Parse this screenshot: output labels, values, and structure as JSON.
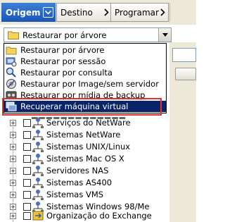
{
  "tabs": [
    {
      "label": "Origem",
      "active": true
    },
    {
      "label": "Destino",
      "active": false
    },
    {
      "label": "Programar",
      "active": false
    }
  ],
  "combo": {
    "value": "Restaurar por árvore"
  },
  "dropdown": {
    "items": [
      {
        "label": "Restaurar por árvore",
        "icon": "folder-icon"
      },
      {
        "label": "Restaurar por sessão",
        "icon": "session-icon"
      },
      {
        "label": "Restaurar por consulta",
        "icon": "query-icon"
      },
      {
        "label": "Restaurar por Image/sem servidor",
        "icon": "image-serverless-icon"
      },
      {
        "label": "Restaurar por mídia de backup",
        "icon": "backup-media-icon"
      },
      {
        "label": "Recuperar máquina virtual",
        "icon": "virtual-machine-icon",
        "selected": true
      }
    ]
  },
  "tree": {
    "items": [
      {
        "label": "Serviços do NetWare",
        "icon": "network-icon"
      },
      {
        "label": "Sistemas NetWare",
        "icon": "network-icon"
      },
      {
        "label": "Sistemas UNIX/Linux",
        "icon": "network-icon"
      },
      {
        "label": "Sistemas Mac OS X",
        "icon": "network-icon"
      },
      {
        "label": "Servidores NAS",
        "icon": "network-icon"
      },
      {
        "label": "Sistemas AS400",
        "icon": "network-icon"
      },
      {
        "label": "Sistemas VMS",
        "icon": "network-icon"
      },
      {
        "label": "Sistemas Windows 98/Me",
        "icon": "network-icon"
      },
      {
        "label": "Organização do Exchange",
        "icon": "exchange-icon"
      }
    ]
  },
  "colors": {
    "tab_active": "#1a55b6",
    "selection": "#0a246a",
    "highlight_border": "#e03030"
  }
}
